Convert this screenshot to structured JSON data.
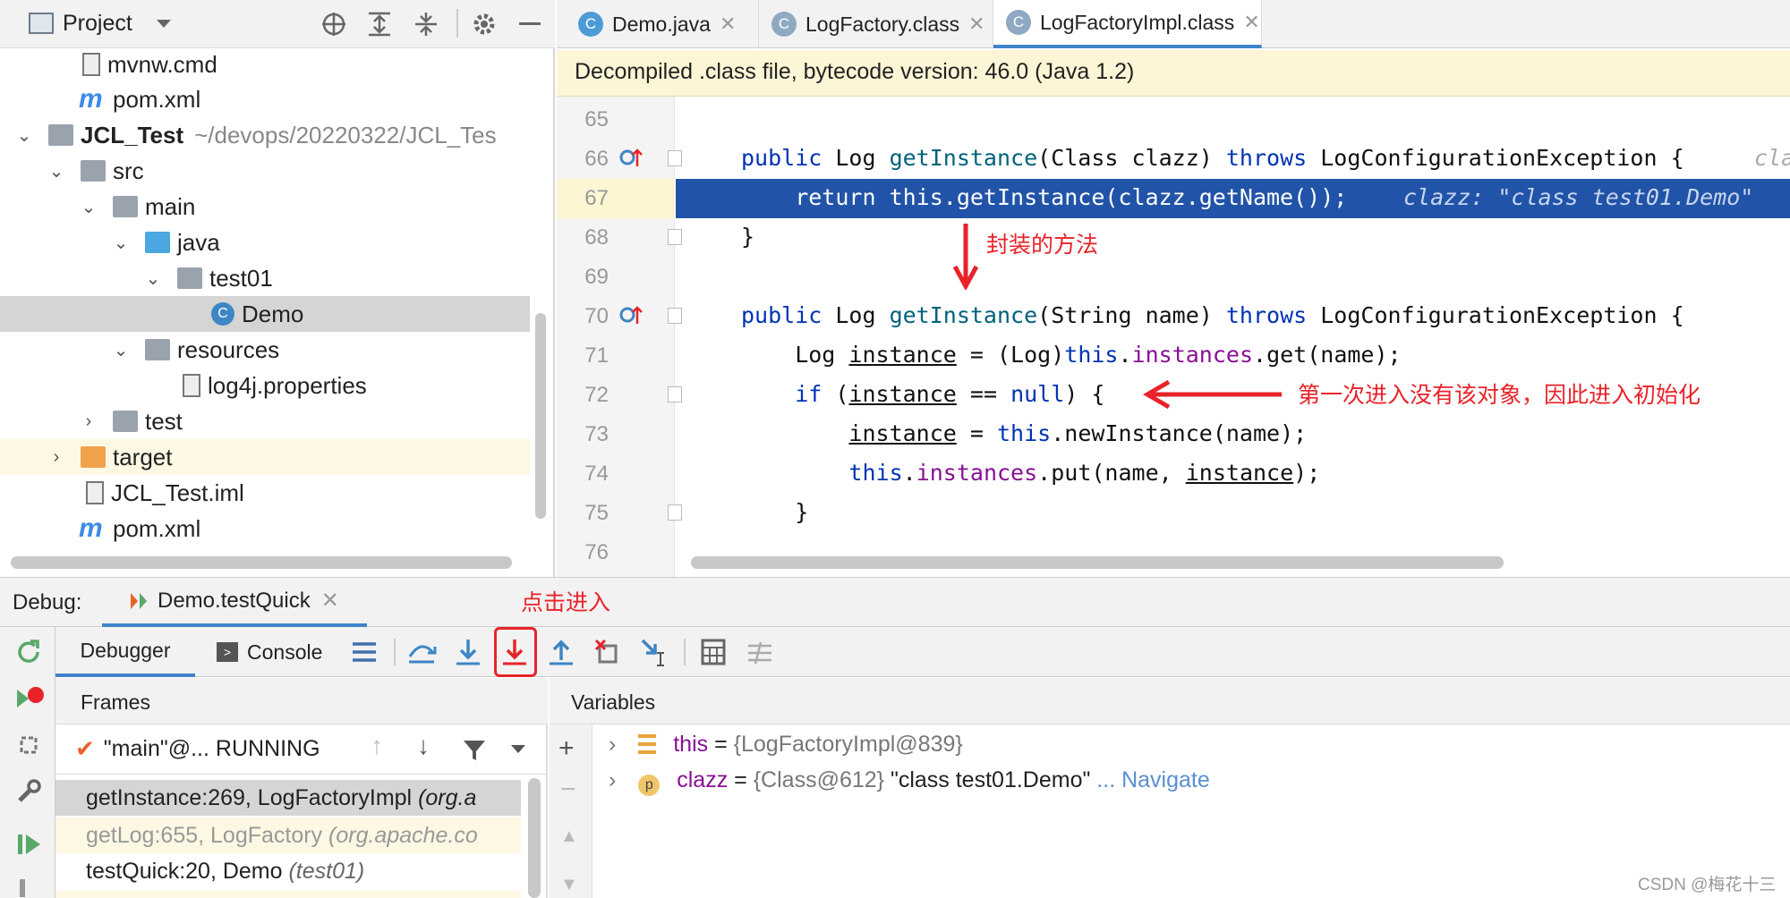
{
  "project": {
    "title": "Project",
    "tree": [
      {
        "label": "mvnw.cmd",
        "type": "file"
      },
      {
        "label": "pom.xml",
        "type": "maven"
      },
      {
        "label": "JCL_Test",
        "hint": "~/devops/20220322/JCL_Tes",
        "type": "module"
      },
      {
        "label": "src",
        "type": "folder"
      },
      {
        "label": "main",
        "type": "folder"
      },
      {
        "label": "java",
        "type": "folder-blue"
      },
      {
        "label": "test01",
        "type": "package"
      },
      {
        "label": "Demo",
        "type": "class"
      },
      {
        "label": "resources",
        "type": "folder"
      },
      {
        "label": "log4j.properties",
        "type": "properties"
      },
      {
        "label": "test",
        "type": "folder"
      },
      {
        "label": "target",
        "type": "folder-orange"
      },
      {
        "label": "JCL_Test.iml",
        "type": "file"
      },
      {
        "label": "pom.xml",
        "type": "maven"
      }
    ]
  },
  "editor": {
    "tabs": [
      {
        "label": "Demo.java",
        "icon": "C"
      },
      {
        "label": "LogFactory.class",
        "icon": "C"
      },
      {
        "label": "LogFactoryImpl.class",
        "icon": "C",
        "active": true
      }
    ],
    "banner": "Decompiled .class file, bytecode version: 46.0 (Java 1.2)",
    "line_numbers": [
      "65",
      "66",
      "67",
      "68",
      "69",
      "70",
      "71",
      "72",
      "73",
      "74",
      "75",
      "76"
    ],
    "code": {
      "l66_a": "public",
      "l66_b": " Log ",
      "l66_c": "getInstance",
      "l66_d": "(Class clazz) ",
      "l66_e": "throws",
      "l66_f": " LogConfigurationException {",
      "l66_trail": "cla",
      "l67": "    return this.getInstance(clazz.getName());",
      "l67_inline": "clazz: \"class test01.Demo\"",
      "l68": "}",
      "l70_a": "public",
      "l70_b": " Log ",
      "l70_c": "getInstance",
      "l70_d": "(String name) ",
      "l70_e": "throws",
      "l70_f": " LogConfigurationException {",
      "l71_a": "    Log ",
      "l71_b": "instance",
      "l71_c": " = (Log)",
      "l71_d": "this",
      "l71_e": ".",
      "l71_f": "instances",
      "l71_g": ".get(name);",
      "l72_a": "    if",
      "l72_b": " (",
      "l72_c": "instance",
      "l72_d": " == ",
      "l72_e": "null",
      "l72_f": ") {",
      "l73_a": "        ",
      "l73_b": "instance",
      "l73_c": " = ",
      "l73_d": "this",
      "l73_e": ".newInstance(name);",
      "l74_a": "        ",
      "l74_b": "this",
      "l74_c": ".",
      "l74_d": "instances",
      "l74_e": ".put(name, ",
      "l74_f": "instance",
      "l74_g": ");",
      "l75": "    }"
    },
    "annotations": {
      "wrapper": "封装的方法",
      "first_entry": "第一次进入没有该对象，因此进入初始化"
    }
  },
  "debug": {
    "label": "Debug:",
    "session_tab": "Demo.testQuick",
    "click_annotation": "点击进入",
    "tabs": [
      "Debugger",
      "Console"
    ],
    "frames_title": "Frames",
    "variables_title": "Variables",
    "thread": "\"main\"@... RUNNING",
    "frames": [
      {
        "method": "getInstance:269, LogFactoryImpl",
        "pkg": "(org.a"
      },
      {
        "method": "getLog:655, LogFactory",
        "pkg": "(org.apache.co"
      },
      {
        "method": "testQuick:20, Demo",
        "pkg": "(test01)"
      }
    ],
    "variables": [
      {
        "name": "this",
        "eq": " = ",
        "value": "{LogFactoryImpl@839}",
        "icon": "field-icon"
      },
      {
        "name": "clazz",
        "eq": " = ",
        "value": "{Class@612}",
        "extra": " \"class test01.Demo\"",
        "link": " ... Navigate",
        "icon": "p"
      }
    ]
  },
  "watermark": "CSDN @梅花十三",
  "colors": {
    "selection": "#2154a8",
    "annotation_red": "#e8232a",
    "keyword": "#0033b3",
    "method": "#00627a",
    "field": "#871094"
  }
}
